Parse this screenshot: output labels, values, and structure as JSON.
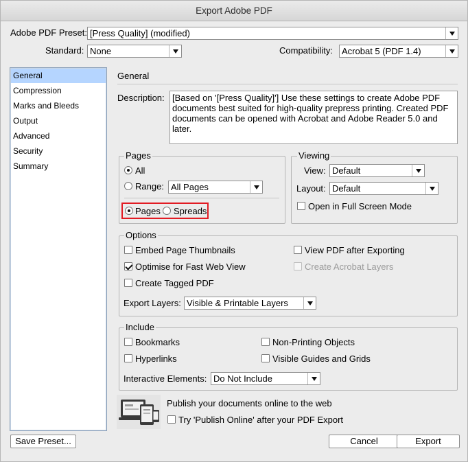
{
  "window": {
    "title": "Export Adobe PDF"
  },
  "header": {
    "preset_label": "Adobe PDF Preset:",
    "preset_value": "[Press Quality] (modified)",
    "standard_label": "Standard:",
    "standard_value": "None",
    "compatibility_label": "Compatibility:",
    "compatibility_value": "Acrobat 5 (PDF 1.4)"
  },
  "sidebar": {
    "items": [
      {
        "label": "General",
        "selected": true
      },
      {
        "label": "Compression"
      },
      {
        "label": "Marks and Bleeds"
      },
      {
        "label": "Output"
      },
      {
        "label": "Advanced"
      },
      {
        "label": "Security"
      },
      {
        "label": "Summary"
      }
    ]
  },
  "general": {
    "heading": "General",
    "description_label": "Description:",
    "description_text": "[Based on '[Press Quality]'] Use these settings to create Adobe PDF documents best suited for high-quality prepress printing.  Created PDF documents can be opened with Acrobat and Adobe Reader 5.0 and later."
  },
  "pages": {
    "title": "Pages",
    "all_label": "All",
    "range_label": "Range:",
    "range_value": "All Pages",
    "pages_label": "Pages",
    "spreads_label": "Spreads"
  },
  "viewing": {
    "title": "Viewing",
    "view_label": "View:",
    "view_value": "Default",
    "layout_label": "Layout:",
    "layout_value": "Default",
    "fullscreen_label": "Open in Full Screen Mode"
  },
  "options": {
    "title": "Options",
    "embed_thumbs": "Embed Page Thumbnails",
    "optimise": "Optimise for Fast Web View",
    "tagged": "Create Tagged PDF",
    "view_after": "View PDF after Exporting",
    "acrobat_layers": "Create Acrobat Layers",
    "export_layers_label": "Export Layers:",
    "export_layers_value": "Visible & Printable Layers"
  },
  "include": {
    "title": "Include",
    "bookmarks": "Bookmarks",
    "hyperlinks": "Hyperlinks",
    "nonprinting": "Non-Printing Objects",
    "guides": "Visible Guides and Grids",
    "interactive_label": "Interactive Elements:",
    "interactive_value": "Do Not Include"
  },
  "publish": {
    "heading": "Publish your documents online to the web",
    "checkbox_label": "Try 'Publish Online' after your PDF Export"
  },
  "buttons": {
    "save_preset": "Save Preset...",
    "cancel": "Cancel",
    "export": "Export"
  }
}
